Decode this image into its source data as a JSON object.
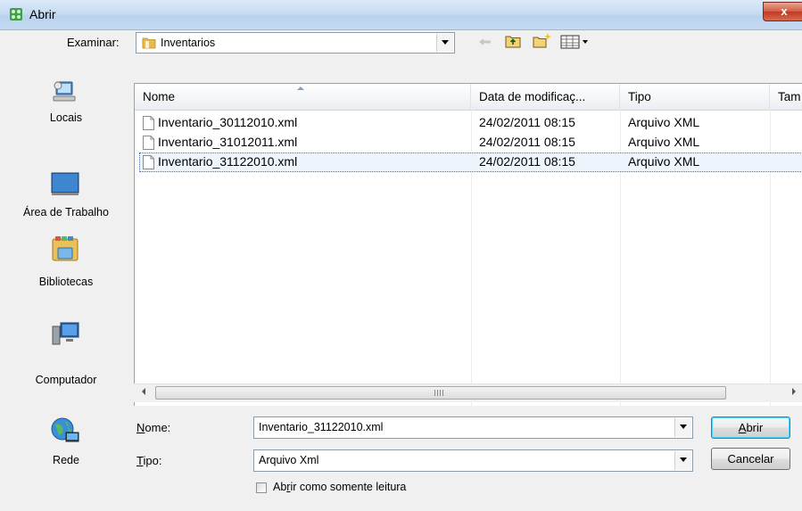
{
  "window": {
    "title": "Abrir",
    "close_label": "x"
  },
  "lookin": {
    "label": "Examinar:",
    "value": "Inventarios"
  },
  "places": [
    {
      "label": "Locais"
    },
    {
      "label": "Área de Trabalho"
    },
    {
      "label": "Bibliotecas"
    },
    {
      "label": "Computador"
    },
    {
      "label": "Rede"
    }
  ],
  "filelist": {
    "columns": [
      "Nome",
      "Data de modificaç...",
      "Tipo",
      "Tam"
    ],
    "rows": [
      {
        "name": "Inventario_30112010.xml",
        "date": "24/02/2011 08:15",
        "type": "Arquivo XML",
        "selected": false
      },
      {
        "name": "Inventario_31012011.xml",
        "date": "24/02/2011 08:15",
        "type": "Arquivo XML",
        "selected": false
      },
      {
        "name": "Inventario_31122010.xml",
        "date": "24/02/2011 08:15",
        "type": "Arquivo XML",
        "selected": true
      }
    ]
  },
  "form": {
    "name_label_u": "N",
    "name_label_rest": "ome:",
    "name_value": "Inventario_31122010.xml",
    "type_label_u": "T",
    "type_label_rest": "ipo:",
    "type_value": "Arquivo Xml",
    "readonly_pre": "Ab",
    "readonly_u": "r",
    "readonly_post": "ir como somente leitura",
    "readonly_checked": false
  },
  "buttons": {
    "open_u": "A",
    "open_rest": "brir",
    "cancel": "Cancelar"
  },
  "colors": {
    "selection_border": "#4a6fa5",
    "selection_fill": "#edf4fc",
    "close_red": "#c2381f"
  }
}
